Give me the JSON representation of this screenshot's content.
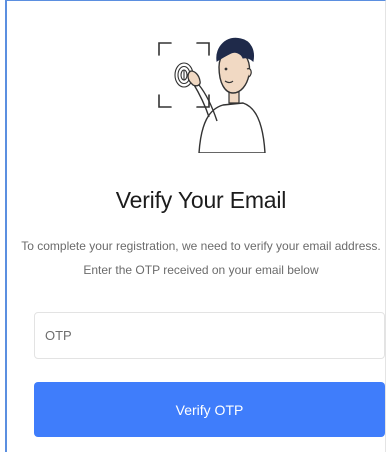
{
  "verify": {
    "title": "Verify Your Email",
    "line1": "To complete your registration, we need to verify your email address.",
    "line2": "Enter the OTP received on your email below",
    "otp_placeholder": "OTP",
    "otp_value": "",
    "button_label": "Verify OTP"
  },
  "illustration": {
    "icon": "fingerprint-scan-person-illustration"
  },
  "colors": {
    "accent": "#3f7dfb",
    "border": "#e3e3e3",
    "title_text": "#1c1c1c",
    "body_text": "#6b6b6b",
    "illustration_skin": "#f1d9c3",
    "illustration_hair": "#1f2a4a"
  }
}
